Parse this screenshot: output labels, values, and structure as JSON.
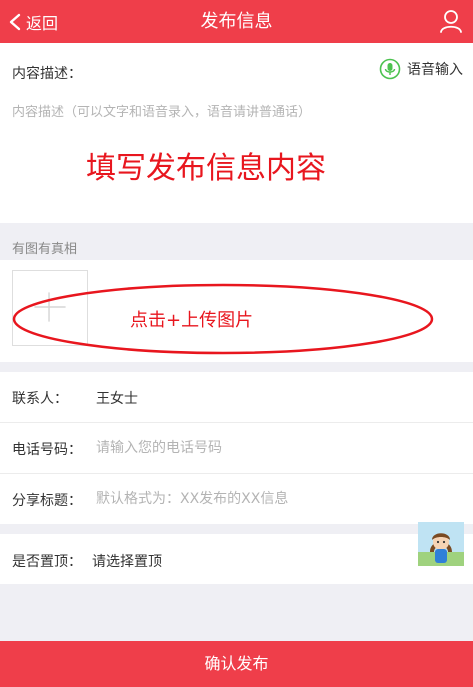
{
  "header": {
    "back_label": "返回",
    "title": "发布信息"
  },
  "description": {
    "label": "内容描述：",
    "voice_label": "语音输入",
    "placeholder": "内容描述（可以文字和语音录入，语音请讲普通话）",
    "annotation": "填写发布信息内容"
  },
  "photos": {
    "section_title": "有图有真相",
    "annotation": "点击+上传图片"
  },
  "form": {
    "contact_label": "联系人：",
    "contact_value": "王女士",
    "phone_label": "电话号码：",
    "phone_placeholder": "请输入您的电话号码",
    "share_label": "分享标题：",
    "share_placeholder": "默认格式为：XX发布的XX信息",
    "top_label": "是否置顶：",
    "top_value": "请选择置顶"
  },
  "submit_label": "确认发布",
  "colors": {
    "accent": "#ef3e4a",
    "annotation": "#e8161e",
    "voice_icon": "#4cc24f"
  }
}
